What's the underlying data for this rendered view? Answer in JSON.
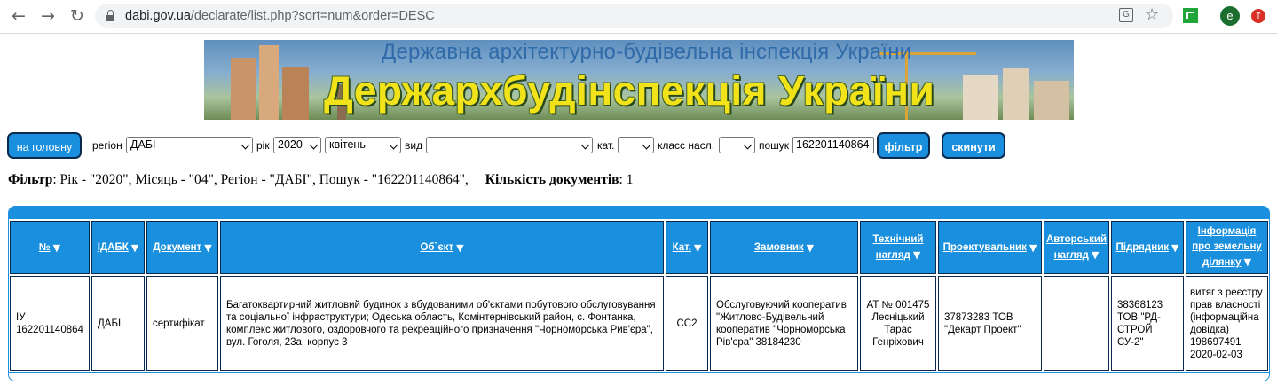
{
  "browser": {
    "url_host": "dabi.gov.ua",
    "url_path": "/declarate/list.php?sort=num&order=DESC",
    "profile_initial": "e",
    "icons": [
      "back-arrow-icon",
      "forward-arrow-icon",
      "reload-icon",
      "lock-icon",
      "translate-icon",
      "star-icon",
      "extension-icon",
      "profile-icon",
      "update-icon"
    ]
  },
  "banner": {
    "subtitle": "Державна архітектурно-будівельна інспекція України",
    "title": "Держархбудінспекція України"
  },
  "filters": {
    "home_button": "на головну",
    "region_label": "регіон",
    "region_value": "ДАБІ",
    "year_label": "рік",
    "year_value": "2020",
    "month_value": "квітень",
    "type_label": "вид",
    "type_value": "",
    "category_label": "кат.",
    "category_value": "",
    "class_label": "класс насл.",
    "class_value": "",
    "search_label": "пошук",
    "search_value": "162201140864",
    "filter_button": "фільтр",
    "reset_button": "скинути"
  },
  "summary": {
    "filter_label": "Фільтр",
    "filter_text": ": Рік - \"2020\", Місяць - \"04\", Регіон - \"ДАБІ\", Пошук - \"162201140864\",",
    "count_label": "Кількість документів",
    "count_text": ": 1"
  },
  "table": {
    "headers": {
      "num": "№",
      "idabk": "ІДАБК",
      "document": "Документ",
      "object": "Об`єкт",
      "cat": "Кат.",
      "customer": "Замовник",
      "tech_sup_1": "Технічний",
      "tech_sup_2": "нагляд",
      "designer": "Проектувальник",
      "author_sup_1": "Авторський",
      "author_sup_2": "нагляд",
      "contractor": "Підрядник",
      "land_1": "Інформація",
      "land_2": "про земельну",
      "land_3": "ділянку"
    },
    "row": {
      "num": "ІУ 162201140864",
      "idabk": "ДАБІ",
      "document": "сертифікат",
      "object": "Багатоквартирний житловий будинок з вбудованими об'єктами побутового обслуговування та соціальної інфраструктури; Одеська область, Комінтернівський район, с. Фонтанка, комплекс житлового, оздоровчого та рекреаційного призначення \"Чорноморська Рив'єра\", вул. Гоголя, 23а, корпус 3",
      "cat": "СС2",
      "customer": "Обслуговуючий кооператив \"Житлово-Будівельний кооператив \"Чорноморська Рів'єра\" 38184230",
      "tech_sup": "АТ № 001475 Лесніцький Тарас Генріхович",
      "designer": "37873283 ТОВ \"Декарт Проект\"",
      "author_sup": "",
      "contractor": "38368123 ТОВ \"РД-СТРОЙ СУ-2\"",
      "land": "витяг з реєстру прав власності (інформаційна довідка) 198697491 2020-02-03"
    }
  },
  "colors": {
    "accent": "#1a8fde",
    "border_dark": "#0a2a4d",
    "banner_title": "#f2e21a",
    "banner_subtitle": "#2f6aa9"
  }
}
